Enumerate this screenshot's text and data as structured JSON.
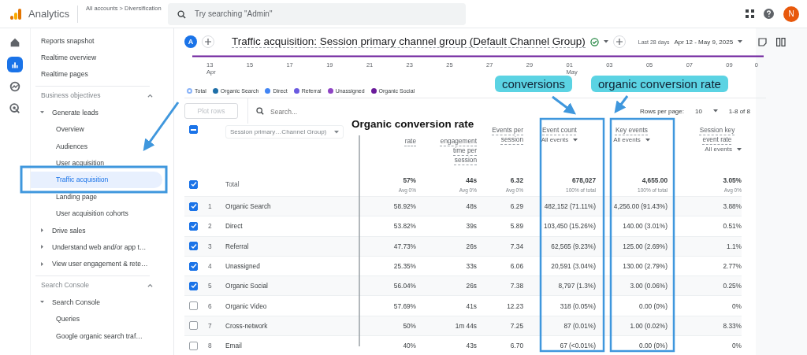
{
  "topbar": {
    "product": "Analytics",
    "breadcrumb": "All accounts > Diversification",
    "search": {
      "placeholder": "Try searching \"Admin\""
    },
    "avatar": "N"
  },
  "rail": [
    {
      "kind": "home",
      "selected": false
    },
    {
      "kind": "reports",
      "selected": true
    },
    {
      "kind": "explore",
      "selected": false
    },
    {
      "kind": "advertising",
      "selected": false
    }
  ],
  "sidebar": {
    "items": [
      {
        "label": "Reports snapshot",
        "selected": false
      },
      {
        "label": "Realtime overview",
        "selected": false
      },
      {
        "label": "Realtime pages",
        "selected": false
      }
    ],
    "sections": [
      {
        "title": "Business objectives",
        "expanded": true,
        "items": [
          {
            "label": "Generate leads",
            "expanded": true,
            "selected": false,
            "children": [
              {
                "label": "Overview",
                "selected": false
              },
              {
                "label": "Audiences",
                "selected": false
              },
              {
                "label": "User acquisition",
                "selected": false
              },
              {
                "label": "Traffic acquisition",
                "selected": true
              },
              {
                "label": "Landing page",
                "selected": false
              },
              {
                "label": "User acquisition cohorts",
                "selected": false
              }
            ]
          },
          {
            "label": "Drive sales",
            "expanded": false,
            "selected": false
          },
          {
            "label": "Understand web and/or app t…",
            "expanded": false,
            "selected": false
          },
          {
            "label": "View user engagement & rete…",
            "expanded": false,
            "selected": false
          }
        ]
      },
      {
        "title": "Search Console",
        "expanded": true,
        "items": [
          {
            "label": "Search Console",
            "expanded": true,
            "selected": false,
            "children": [
              {
                "label": "Queries",
                "selected": false
              },
              {
                "label": "Google organic search traf…",
                "selected": false
              }
            ]
          }
        ]
      }
    ]
  },
  "report": {
    "comparison_badge": "A",
    "title": "Traffic acquisition: Session primary channel group (Default Channel Group)",
    "date_range_label": "Last 28 days",
    "date_range": "Apr 12 - May 9, 2025"
  },
  "chart": {
    "x_labels": [
      {
        "day": "13",
        "month": "Apr"
      },
      {
        "day": "15"
      },
      {
        "day": "17"
      },
      {
        "day": "19"
      },
      {
        "day": "21"
      },
      {
        "day": "23"
      },
      {
        "day": "25"
      },
      {
        "day": "27"
      },
      {
        "day": "29"
      },
      {
        "day": "01",
        "month": "May"
      },
      {
        "day": "03"
      },
      {
        "day": "05"
      },
      {
        "day": "07"
      },
      {
        "day": "09"
      }
    ],
    "y_label": "0",
    "legend": [
      {
        "label": "Total",
        "kind": "outline",
        "color": "#8ab4f8"
      },
      {
        "label": "Organic Search",
        "kind": "dot",
        "color": "#1e6fa8"
      },
      {
        "label": "Direct",
        "kind": "dot",
        "color": "#4285f4"
      },
      {
        "label": "Referral",
        "kind": "dot",
        "color": "#6a5ae0"
      },
      {
        "label": "Unassigned",
        "kind": "dot",
        "color": "#8e44c4"
      },
      {
        "label": "Organic Social",
        "kind": "dot",
        "color": "#6a1b9a"
      }
    ]
  },
  "toolbar": {
    "plot_rows": {
      "label": "Plot rows",
      "disabled": true
    },
    "search": {
      "placeholder": "Search..."
    },
    "rows_per_page_label": "Rows per page:",
    "rows_per_page": "10",
    "page_info": "1-8 of 8"
  },
  "table": {
    "header_checkbox": {
      "indeterminate": true
    },
    "dimension": "Session primary…Channel Group)",
    "columns": [
      {
        "label": "rate"
      },
      {
        "label": "engagement time per session"
      },
      {
        "label": "Events per session"
      },
      {
        "label": "Event count",
        "filter": "All events"
      },
      {
        "label": "Key events",
        "filter": "All events"
      },
      {
        "label": "Session key event rate",
        "filter": "All events"
      }
    ],
    "total": {
      "checked": true,
      "label": "Total",
      "values": [
        {
          "value": "57%",
          "note": "Avg 0%"
        },
        {
          "value": "44s",
          "note": "Avg 0%"
        },
        {
          "value": "6.32",
          "note": "Avg 0%"
        },
        {
          "value": "678,027",
          "note": "100% of total"
        },
        {
          "value": "4,655.00",
          "note": "100% of total"
        },
        {
          "value": "3.05%",
          "note": "Avg 0%"
        }
      ]
    },
    "rows": [
      {
        "checked": true,
        "index": "1",
        "channel": "Organic Search",
        "values": [
          "58.92%",
          "48s",
          "6.29",
          "482,152 (71.11%)",
          "4,256.00 (91.43%)",
          "3.88%"
        ]
      },
      {
        "checked": true,
        "index": "2",
        "channel": "Direct",
        "values": [
          "53.82%",
          "39s",
          "5.89",
          "103,450 (15.26%)",
          "140.00 (3.01%)",
          "0.51%"
        ]
      },
      {
        "checked": true,
        "index": "3",
        "channel": "Referral",
        "values": [
          "47.73%",
          "26s",
          "7.34",
          "62,565 (9.23%)",
          "125.00 (2.69%)",
          "1.1%"
        ]
      },
      {
        "checked": true,
        "index": "4",
        "channel": "Unassigned",
        "values": [
          "25.35%",
          "33s",
          "6.06",
          "20,591 (3.04%)",
          "130.00 (2.79%)",
          "2.77%"
        ]
      },
      {
        "checked": true,
        "index": "5",
        "channel": "Organic Social",
        "values": [
          "56.04%",
          "26s",
          "7.38",
          "8,797 (1.3%)",
          "3.00 (0.06%)",
          "0.25%"
        ]
      },
      {
        "checked": false,
        "index": "6",
        "channel": "Organic Video",
        "values": [
          "57.69%",
          "41s",
          "12.23",
          "318 (0.05%)",
          "0.00 (0%)",
          "0%"
        ]
      },
      {
        "checked": false,
        "index": "7",
        "channel": "Cross-network",
        "values": [
          "50%",
          "1m 44s",
          "7.25",
          "87 (0.01%)",
          "1.00 (0.02%)",
          "8.33%"
        ]
      },
      {
        "checked": false,
        "index": "8",
        "channel": "Email",
        "values": [
          "40%",
          "43s",
          "6.70",
          "67 (<0.01%)",
          "0.00 (0%)",
          "0%"
        ]
      }
    ]
  },
  "annotations": {
    "heading": "Organic conversion rate",
    "callouts": [
      "conversions",
      "organic conversion rate"
    ]
  }
}
